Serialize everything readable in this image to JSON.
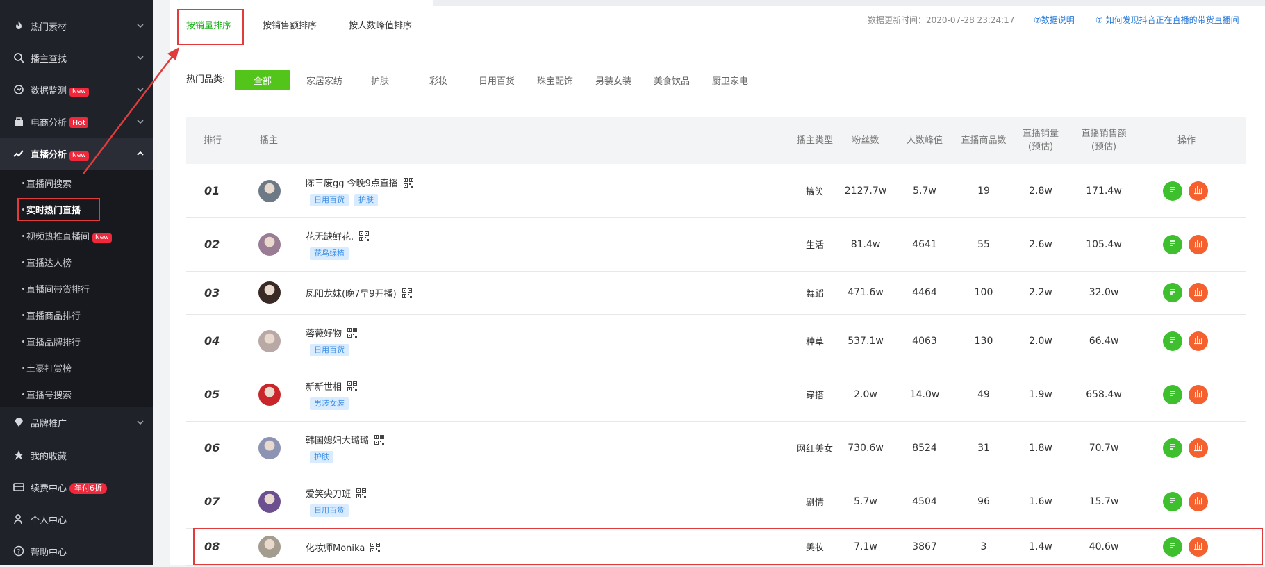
{
  "sidebar": {
    "items": [
      {
        "label": "热门素材",
        "icon": "flame-icon"
      },
      {
        "label": "播主查找",
        "icon": "search-icon"
      },
      {
        "label": "数据监测",
        "icon": "monitor-icon",
        "badge": "New"
      },
      {
        "label": "电商分析",
        "icon": "bag-icon",
        "badge": "Hot"
      },
      {
        "label": "直播分析",
        "icon": "trend-icon",
        "badge": "New"
      },
      {
        "label": "品牌推广",
        "icon": "diamond-icon"
      },
      {
        "label": "我的收藏",
        "icon": "star-icon"
      },
      {
        "label": "续费中心",
        "icon": "card-icon",
        "badge": "年付6折"
      },
      {
        "label": "个人中心",
        "icon": "user-icon"
      },
      {
        "label": "帮助中心",
        "icon": "help-icon"
      }
    ],
    "submenu": [
      {
        "label": "直播间搜索"
      },
      {
        "label": "实时热门直播"
      },
      {
        "label": "视频热推直播间",
        "badge": "New"
      },
      {
        "label": "直播达人榜"
      },
      {
        "label": "直播间带货排行"
      },
      {
        "label": "直播商品排行"
      },
      {
        "label": "直播品牌排行"
      },
      {
        "label": "土豪打赏榜"
      },
      {
        "label": "直播号搜索"
      }
    ]
  },
  "sort_tabs": [
    "按销量排序",
    "按销售额排序",
    "按人数峰值排序"
  ],
  "update_time": "数据更新时间：2020-07-28 23:24:17",
  "help_links": [
    "⑦数据说明",
    "⑦ 如何发现抖音正在直播的带货直播间"
  ],
  "categories": {
    "label": "热门品类:",
    "items": [
      "全部",
      "家居家纺",
      "护肤",
      "彩妆",
      "日用百货",
      "珠宝配饰",
      "男装女装",
      "美食饮品",
      "厨卫家电"
    ]
  },
  "table": {
    "headers": [
      "排行",
      "播主",
      "播主类型",
      "粉丝数",
      "人数峰值",
      "直播商品数",
      "直播销量\n(预估)",
      "直播销售额\n(预估)",
      "操作"
    ],
    "rows": [
      {
        "rank": "01",
        "name": "陈三废gg 今晚9点直播",
        "tags": [
          "日用百货",
          "护肤"
        ],
        "type": "搞笑",
        "fans": "2127.7w",
        "peak": "5.7w",
        "products": "19",
        "sales": "2.8w",
        "revenue": "171.4w",
        "avatar_color": "#6d7a86"
      },
      {
        "rank": "02",
        "name": "花无缺鲜花.",
        "tags": [
          "花鸟绿植"
        ],
        "type": "生活",
        "fans": "81.4w",
        "peak": "4641",
        "products": "55",
        "sales": "2.6w",
        "revenue": "105.4w",
        "avatar_color": "#9a7c94"
      },
      {
        "rank": "03",
        "name": "凤阳龙妹(晚7早9开播)",
        "tags": [],
        "type": "舞蹈",
        "fans": "471.6w",
        "peak": "4464",
        "products": "100",
        "sales": "2.2w",
        "revenue": "32.0w",
        "avatar_color": "#3a2a26"
      },
      {
        "rank": "04",
        "name": "蓉薇好物",
        "tags": [
          "日用百货"
        ],
        "type": "种草",
        "fans": "537.1w",
        "peak": "4063",
        "products": "130",
        "sales": "2.0w",
        "revenue": "66.4w",
        "avatar_color": "#b9a9a6"
      },
      {
        "rank": "05",
        "name": "新新世相",
        "tags": [
          "男装女装"
        ],
        "type": "穿搭",
        "fans": "2.0w",
        "peak": "14.0w",
        "products": "49",
        "sales": "1.9w",
        "revenue": "658.4w",
        "avatar_color": "#c8262b"
      },
      {
        "rank": "06",
        "name": "韩国媳妇大璐璐",
        "tags": [
          "护肤"
        ],
        "type": "网红美女",
        "fans": "730.6w",
        "peak": "8524",
        "products": "31",
        "sales": "1.8w",
        "revenue": "70.7w",
        "avatar_color": "#8d93b3"
      },
      {
        "rank": "07",
        "name": "爱笑尖刀班",
        "tags": [
          "日用百货"
        ],
        "type": "剧情",
        "fans": "5.7w",
        "peak": "4504",
        "products": "96",
        "sales": "1.6w",
        "revenue": "15.7w",
        "avatar_color": "#6b4f8e"
      },
      {
        "rank": "08",
        "name": "化妆师Monika",
        "tags": [],
        "type": "美妆",
        "fans": "7.1w",
        "peak": "3867",
        "products": "3",
        "sales": "1.4w",
        "revenue": "40.6w",
        "avatar_color": "#a59c90"
      }
    ]
  },
  "colors": {
    "accent": "#1aad19",
    "active_green": "#52c41a",
    "highlight_red": "#e23b3b",
    "chart_orange": "#f5612e"
  }
}
